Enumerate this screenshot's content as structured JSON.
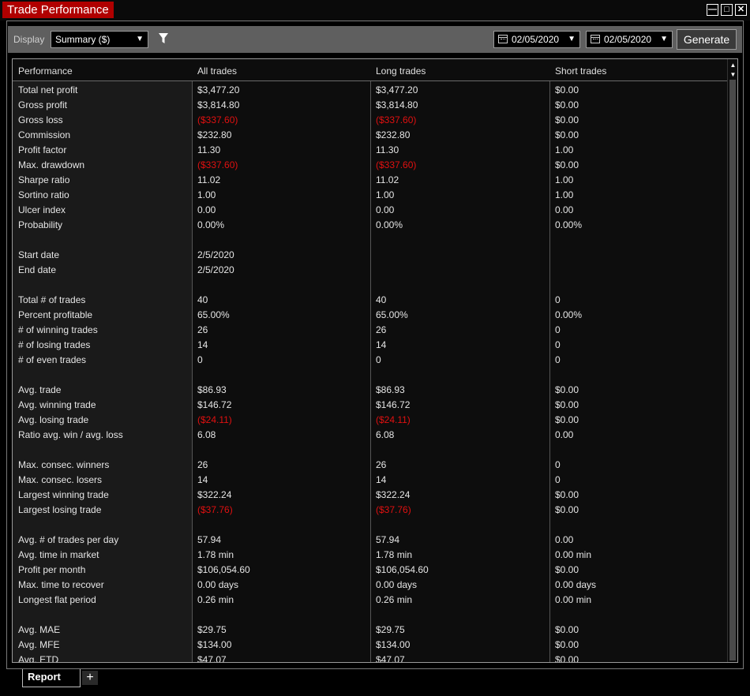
{
  "window": {
    "title": "Trade Performance",
    "buttons": [
      "minimize",
      "maximize",
      "close"
    ]
  },
  "toolbar": {
    "display_label": "Display",
    "display_value": "Summary ($)",
    "date_from": "02/05/2020",
    "date_to": "02/05/2020",
    "generate_label": "Generate"
  },
  "table": {
    "columns": [
      "Performance",
      "All trades",
      "Long trades",
      "Short trades"
    ],
    "rows": [
      [
        "Total net profit",
        "$3,477.20",
        "$3,477.20",
        "$0.00"
      ],
      [
        "Gross profit",
        "$3,814.80",
        "$3,814.80",
        "$0.00"
      ],
      [
        "Gross loss",
        "($337.60)",
        "($337.60)",
        "$0.00"
      ],
      [
        "Commission",
        "$232.80",
        "$232.80",
        "$0.00"
      ],
      [
        "Profit factor",
        "11.30",
        "11.30",
        "1.00"
      ],
      [
        "Max. drawdown",
        "($337.60)",
        "($337.60)",
        "$0.00"
      ],
      [
        "Sharpe ratio",
        "11.02",
        "11.02",
        "1.00"
      ],
      [
        "Sortino ratio",
        "1.00",
        "1.00",
        "1.00"
      ],
      [
        "Ulcer index",
        "0.00",
        "0.00",
        "0.00"
      ],
      [
        "Probability",
        "0.00%",
        "0.00%",
        "0.00%"
      ],
      [
        "",
        "",
        "",
        ""
      ],
      [
        "Start date",
        "2/5/2020",
        "",
        ""
      ],
      [
        "End date",
        "2/5/2020",
        "",
        ""
      ],
      [
        "",
        "",
        "",
        ""
      ],
      [
        "Total # of trades",
        "40",
        "40",
        "0"
      ],
      [
        "Percent profitable",
        "65.00%",
        "65.00%",
        "0.00%"
      ],
      [
        "# of winning trades",
        "26",
        "26",
        "0"
      ],
      [
        "# of losing trades",
        "14",
        "14",
        "0"
      ],
      [
        "# of even trades",
        "0",
        "0",
        "0"
      ],
      [
        "",
        "",
        "",
        ""
      ],
      [
        "Avg. trade",
        "$86.93",
        "$86.93",
        "$0.00"
      ],
      [
        "Avg. winning trade",
        "$146.72",
        "$146.72",
        "$0.00"
      ],
      [
        "Avg. losing trade",
        "($24.11)",
        "($24.11)",
        "$0.00"
      ],
      [
        "Ratio avg. win / avg. loss",
        "6.08",
        "6.08",
        "0.00"
      ],
      [
        "",
        "",
        "",
        ""
      ],
      [
        "Max. consec. winners",
        "26",
        "26",
        "0"
      ],
      [
        "Max. consec. losers",
        "14",
        "14",
        "0"
      ],
      [
        "Largest winning trade",
        "$322.24",
        "$322.24",
        "$0.00"
      ],
      [
        "Largest losing trade",
        "($37.76)",
        "($37.76)",
        "$0.00"
      ],
      [
        "",
        "",
        "",
        ""
      ],
      [
        "Avg. # of trades per day",
        "57.94",
        "57.94",
        "0.00"
      ],
      [
        "Avg. time in market",
        "1.78 min",
        "1.78 min",
        "0.00 min"
      ],
      [
        "Profit per month",
        "$106,054.60",
        "$106,054.60",
        "$0.00"
      ],
      [
        "Max. time to recover",
        "0.00 days",
        "0.00 days",
        "0.00 days"
      ],
      [
        "Longest flat period",
        "0.26 min",
        "0.26 min",
        "0.00 min"
      ],
      [
        "",
        "",
        "",
        ""
      ],
      [
        "Avg. MAE",
        "$29.75",
        "$29.75",
        "$0.00"
      ],
      [
        "Avg. MFE",
        "$134.00",
        "$134.00",
        "$0.00"
      ],
      [
        "Avg. ETD",
        "$47.07",
        "$47.07",
        "$0.00"
      ]
    ]
  },
  "tabs": {
    "active": "Report",
    "add_label": "+"
  },
  "colors": {
    "title_bg": "#b00000",
    "negative": "#e01010"
  }
}
